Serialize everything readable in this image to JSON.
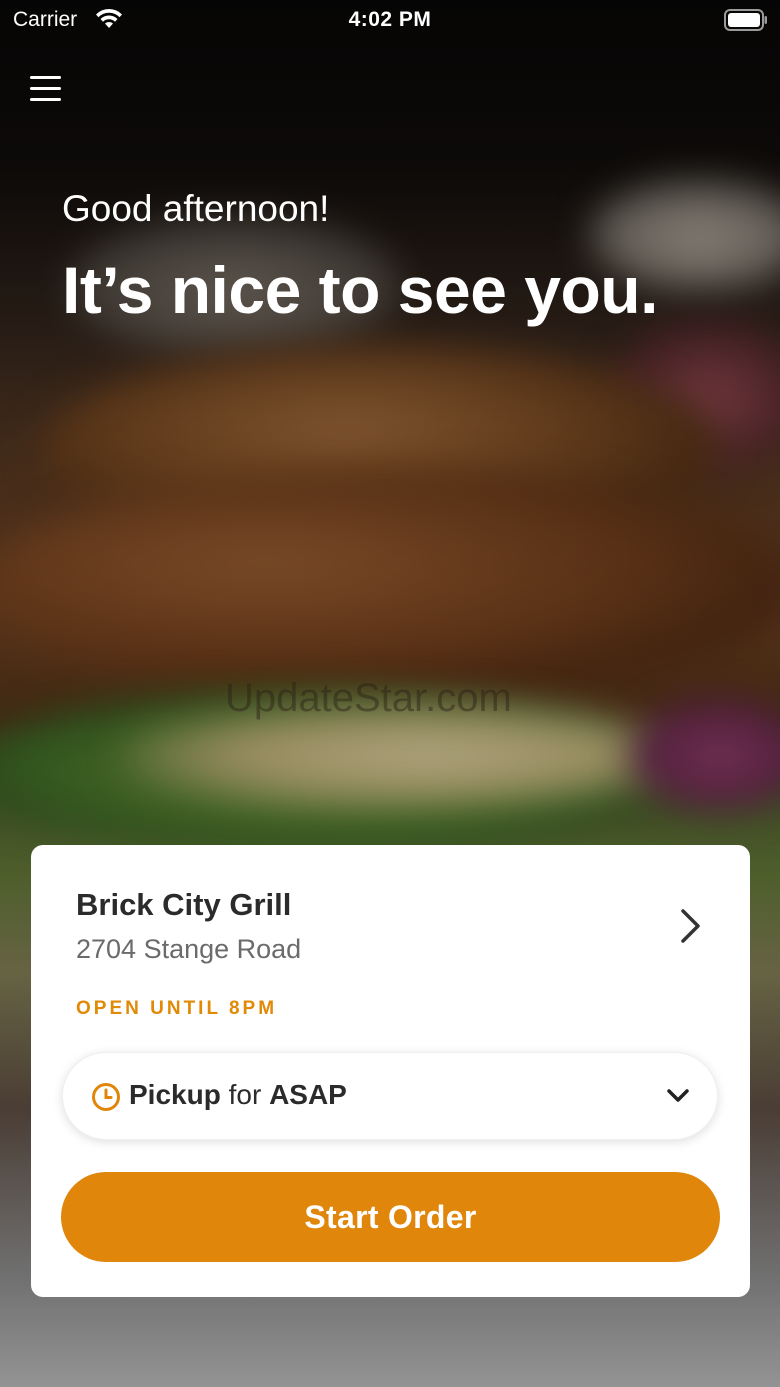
{
  "status_bar": {
    "carrier": "Carrier",
    "time": "4:02 PM",
    "icons": [
      "wifi-icon",
      "battery-icon"
    ]
  },
  "header": {
    "menu_icon": "hamburger-menu-icon"
  },
  "hero": {
    "greeting": "Good afternoon!",
    "headline": "It’s nice to see you.",
    "watermark": "UpdateStar.com"
  },
  "location_card": {
    "name": "Brick City Grill",
    "address": "2704 Stange Road",
    "open_status": "OPEN UNTIL 8PM",
    "pickup": {
      "mode": "Pickup",
      "connector": "for",
      "time": "ASAP",
      "icon": "clock-icon"
    },
    "start_order_label": "Start Order"
  },
  "colors": {
    "accent": "#e0860a",
    "status_text": "#e08a06",
    "card_bg": "#ffffff",
    "text_dark": "#2b2b2b",
    "text_muted": "#6b6b6b"
  }
}
